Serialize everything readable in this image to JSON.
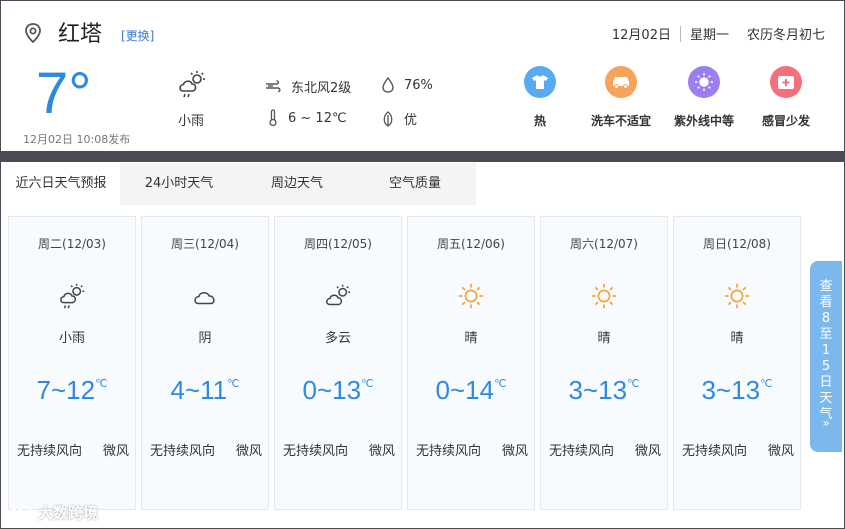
{
  "header": {
    "city": "红塔",
    "change_link": "[更换]",
    "date": "12月02日",
    "weekday": "星期一",
    "lunar": "农历冬月初七"
  },
  "current": {
    "temp": "7°",
    "publish_time": "12月02日 10:08发布",
    "condition": "小雨",
    "condition_icon": "light-rain-icon",
    "wind": "东北风2级",
    "humidity": "76%",
    "temp_range": "6 ~ 12℃",
    "air_quality": "优"
  },
  "indices": [
    {
      "label": "热",
      "icon": "shirt-icon",
      "color": "#5aaaf0"
    },
    {
      "label": "洗车不适宜",
      "icon": "car-icon",
      "color": "#f7a35c"
    },
    {
      "label": "紫外线中等",
      "icon": "uv-icon",
      "color": "#9b7ff0"
    },
    {
      "label": "感冒少发",
      "icon": "medkit-icon",
      "color": "#f5707a"
    }
  ],
  "tabs": [
    "近六日天气预报",
    "24小时天气",
    "周边天气",
    "空气质量"
  ],
  "days": [
    {
      "date": "周二(12/03)",
      "cond": "小雨",
      "icon": "light-rain-icon",
      "low": "7",
      "high": "12",
      "wind_dir": "无持续风向",
      "wind_level": "微风"
    },
    {
      "date": "周三(12/04)",
      "cond": "阴",
      "icon": "cloud-icon",
      "low": "4",
      "high": "11",
      "wind_dir": "无持续风向",
      "wind_level": "微风"
    },
    {
      "date": "周四(12/05)",
      "cond": "多云",
      "icon": "partly-cloudy-icon",
      "low": "0",
      "high": "13",
      "wind_dir": "无持续风向",
      "wind_level": "微风"
    },
    {
      "date": "周五(12/06)",
      "cond": "晴",
      "icon": "sun-icon",
      "low": "0",
      "high": "14",
      "wind_dir": "无持续风向",
      "wind_level": "微风"
    },
    {
      "date": "周六(12/07)",
      "cond": "晴",
      "icon": "sun-icon",
      "low": "3",
      "high": "13",
      "wind_dir": "无持续风向",
      "wind_level": "微风"
    },
    {
      "date": "周日(12/08)",
      "cond": "晴",
      "icon": "sun-icon",
      "low": "3",
      "high": "13",
      "wind_dir": "无持续风向",
      "wind_level": "微风"
    }
  ],
  "day_temp": [
    {
      "range": "7~12",
      "unit": "℃"
    },
    {
      "range": "4~11",
      "unit": "℃"
    },
    {
      "range": "0~13",
      "unit": "℃"
    },
    {
      "range": "0~14",
      "unit": "℃"
    },
    {
      "range": "3~13",
      "unit": "℃"
    },
    {
      "range": "3~13",
      "unit": "℃"
    }
  ],
  "side_button": {
    "label": "查看8至15日天气",
    "arrow": "»"
  },
  "watermark": "大数跨境"
}
